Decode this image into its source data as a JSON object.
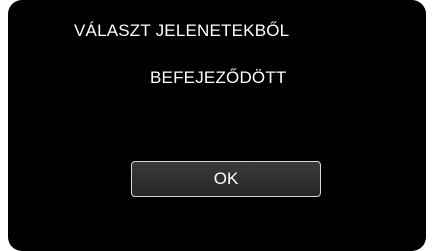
{
  "dialog": {
    "title": "VÁLASZT JELENETEKBŐL",
    "message": "BEFEJEZŐDÖTT",
    "ok_label": "OK"
  },
  "colors": {
    "screen_background": "#000000",
    "text": "#ffffff",
    "button_border": "#d7d7d7"
  }
}
